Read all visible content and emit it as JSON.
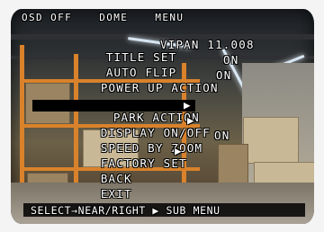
{
  "menu": {
    "header": [
      "OSD OFF",
      "DOME",
      "MENU"
    ],
    "items": [
      {
        "label": "TITLE SET",
        "value": "VIPAN 11.008"
      },
      {
        "label": "AUTO FLIP",
        "value": "ON"
      },
      {
        "label": "POWER UP ACTION",
        "value": "ON"
      },
      {
        "label": "PARK ACTION",
        "value": "▶"
      },
      {
        "label": "DISPLAY ON/OFF",
        "value": "▶"
      },
      {
        "label": "SPEED BY ZOOM",
        "value": "ON"
      },
      {
        "label": "FACTORY SET",
        "value": "▶"
      },
      {
        "label": "BACK",
        "value": ""
      },
      {
        "label": "EXIT",
        "value": ""
      }
    ],
    "selected_index": 3,
    "footer": "SELECT→NEAR/RIGHT ▶ SUB MENU"
  },
  "colors": {
    "osd_text": "#ffffff",
    "selection_bg": "#000000"
  }
}
